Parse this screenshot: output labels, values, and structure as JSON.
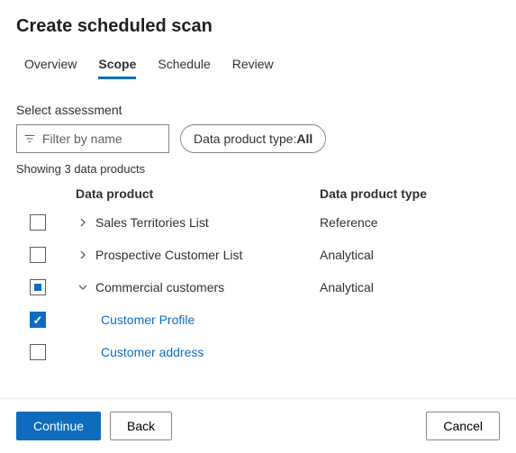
{
  "title": "Create scheduled scan",
  "tabs": {
    "overview": "Overview",
    "scope": "Scope",
    "schedule": "Schedule",
    "review": "Review"
  },
  "section_label": "Select assessment",
  "filter": {
    "placeholder": "Filter by name"
  },
  "type_pill": {
    "prefix": "Data product type: ",
    "value": "All"
  },
  "showing_text": "Showing 3 data products",
  "columns": {
    "name": "Data product",
    "type": "Data product type"
  },
  "rows": {
    "r0": {
      "name": "Sales Territories List",
      "type": "Reference"
    },
    "r1": {
      "name": "Prospective Customer List",
      "type": "Analytical"
    },
    "r2": {
      "name": "Commercial customers",
      "type": "Analytical"
    },
    "r3": {
      "name": "Customer Profile"
    },
    "r4": {
      "name": "Customer address"
    }
  },
  "buttons": {
    "continue": "Continue",
    "back": "Back",
    "cancel": "Cancel"
  }
}
